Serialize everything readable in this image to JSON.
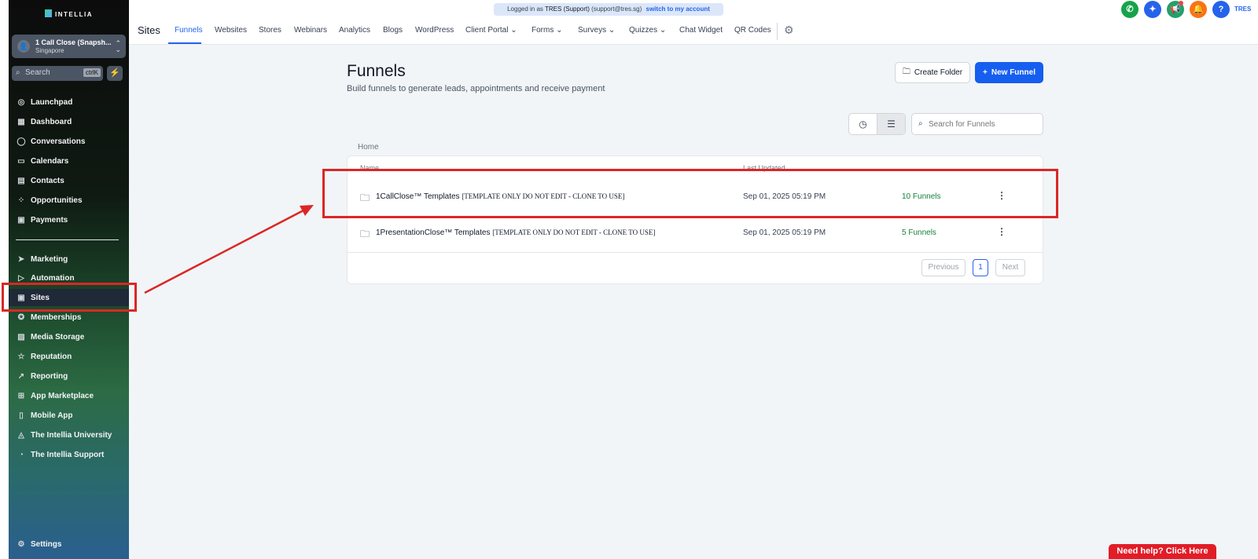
{
  "banner": {
    "prefix": "Logged in as",
    "user": "TRES (Support)",
    "email": "(support@tres.sg)",
    "switch_label": "switch to my account"
  },
  "sidebar": {
    "brand": "INTELLIA",
    "account": {
      "name": "1 Call Close (Snapsh...",
      "location": "Singapore"
    },
    "search": {
      "placeholder": "Search",
      "shortcut": "ctrlK"
    },
    "items_top": [
      {
        "label": "Launchpad",
        "icon": "rocket-icon"
      },
      {
        "label": "Dashboard",
        "icon": "dashboard-icon"
      },
      {
        "label": "Conversations",
        "icon": "chat-icon"
      },
      {
        "label": "Calendars",
        "icon": "calendar-icon"
      },
      {
        "label": "Contacts",
        "icon": "contacts-icon"
      },
      {
        "label": "Opportunities",
        "icon": "opportunities-icon"
      },
      {
        "label": "Payments",
        "icon": "payments-icon"
      }
    ],
    "items_bottom": [
      {
        "label": "Marketing",
        "icon": "send-icon"
      },
      {
        "label": "Automation",
        "icon": "automation-icon"
      },
      {
        "label": "Sites",
        "icon": "sites-icon"
      },
      {
        "label": "Memberships",
        "icon": "membership-icon"
      },
      {
        "label": "Media Storage",
        "icon": "image-icon"
      },
      {
        "label": "Reputation",
        "icon": "star-icon"
      },
      {
        "label": "Reporting",
        "icon": "trend-icon"
      },
      {
        "label": "App Marketplace",
        "icon": "grid-icon"
      },
      {
        "label": "Mobile App",
        "icon": "phone-icon"
      },
      {
        "label": "The Intellia University",
        "icon": "graduation-icon"
      },
      {
        "label": "The Intellia Support",
        "icon": "support-icon"
      }
    ],
    "settings": "Settings"
  },
  "header": {
    "section_title": "Sites",
    "tabs": [
      "Funnels",
      "Websites",
      "Stores",
      "Webinars",
      "Analytics",
      "Blogs",
      "WordPress",
      "Client Portal",
      "Forms",
      "Surveys",
      "Quizzes",
      "Chat Widget",
      "QR Codes"
    ],
    "user_initials": "TRES"
  },
  "page": {
    "title": "Funnels",
    "subtitle": "Build funnels to generate leads, appointments and receive payment",
    "create_folder_label": "Create Folder",
    "new_funnel_label": "New Funnel",
    "search_placeholder": "Search for Funnels",
    "breadcrumb": "Home",
    "columns": {
      "name": "Name",
      "last_updated": "Last Updated"
    },
    "rows": [
      {
        "name": "1CallClose™ Templates",
        "tag": "[TEMPLATE ONLY DO NOT EDIT - CLONE TO USE]",
        "updated": "Sep 01, 2025 05:19 PM",
        "count": "10 Funnels"
      },
      {
        "name": "1PresentationClose™ Templates",
        "tag": "[TEMPLATE ONLY DO NOT EDIT - CLONE TO USE]",
        "updated": "Sep 01, 2025 05:19 PM",
        "count": "5 Funnels"
      }
    ],
    "pagination": {
      "previous": "Previous",
      "current": "1",
      "next": "Next"
    }
  },
  "help_button": "Need help? Click Here",
  "colors": {
    "accent": "#155eef",
    "annotation": "#dc2626",
    "count_green": "#15803d"
  }
}
